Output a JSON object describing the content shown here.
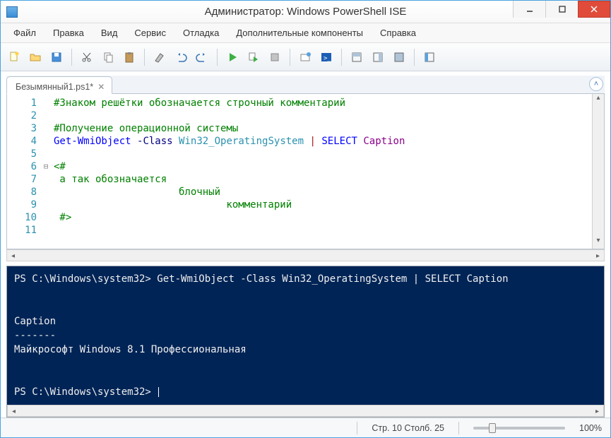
{
  "window": {
    "title": "Администратор: Windows PowerShell ISE"
  },
  "menu": {
    "file": "Файл",
    "edit": "Правка",
    "view": "Вид",
    "tools": "Сервис",
    "debug": "Отладка",
    "addons": "Дополнительные компоненты",
    "help": "Справка"
  },
  "toolbar_icons": {
    "new": "new-file",
    "open": "open-folder",
    "save": "save",
    "cut": "cut",
    "copy": "copy",
    "paste": "paste",
    "clear": "clear",
    "undo": "undo",
    "redo": "redo",
    "run": "run",
    "run_sel": "run-selection",
    "stop": "stop",
    "new_remote": "new-remote-tab",
    "ps": "start-powershell",
    "pane1": "show-script-top",
    "pane2": "show-script-right",
    "pane3": "show-script-max",
    "cmd_addon": "show-command-addon"
  },
  "tab": {
    "label": "Безымянный1.ps1*"
  },
  "editor": {
    "line_numbers": [
      "1",
      "2",
      "3",
      "4",
      "5",
      "6",
      "7",
      "8",
      "9",
      "10",
      "11"
    ],
    "fold_markers": {
      "6": "⊟"
    },
    "lines": [
      {
        "segments": [
          {
            "t": "#Знаком решётки обозначается строчный комментарий",
            "c": "c-comment"
          }
        ]
      },
      {
        "segments": []
      },
      {
        "segments": [
          {
            "t": "#Получение операционной системы",
            "c": "c-comment"
          }
        ]
      },
      {
        "segments": [
          {
            "t": "Get-WmiObject",
            "c": "c-cmd"
          },
          {
            "t": " ",
            "c": ""
          },
          {
            "t": "-Class",
            "c": "c-param"
          },
          {
            "t": " ",
            "c": ""
          },
          {
            "t": "Win32_OperatingSystem",
            "c": "c-type"
          },
          {
            "t": " ",
            "c": ""
          },
          {
            "t": "|",
            "c": "c-op"
          },
          {
            "t": " ",
            "c": ""
          },
          {
            "t": "SELECT",
            "c": "c-kw"
          },
          {
            "t": " ",
            "c": ""
          },
          {
            "t": "Caption",
            "c": "c-ident"
          }
        ]
      },
      {
        "segments": []
      },
      {
        "segments": [
          {
            "t": "<#",
            "c": "c-comment"
          }
        ]
      },
      {
        "segments": [
          {
            "t": " а так обозначается",
            "c": "c-comment"
          }
        ]
      },
      {
        "segments": [
          {
            "t": "                     блочный",
            "c": "c-comment"
          }
        ]
      },
      {
        "segments": [
          {
            "t": "                             комментарий",
            "c": "c-comment"
          }
        ]
      },
      {
        "segments": [
          {
            "t": " #>",
            "c": "c-comment"
          }
        ]
      },
      {
        "segments": []
      }
    ]
  },
  "console_output": {
    "prompt1": "PS C:\\Windows\\system32>",
    "cmd1": " Get-WmiObject -Class Win32_OperatingSystem | SELECT Caption",
    "blank": "",
    "hdr": "Caption",
    "rule": "-------",
    "val": "Майкрософт Windows 8.1 Профессиональная",
    "prompt2": "PS C:\\Windows\\system32> "
  },
  "status": {
    "pos": "Стр. 10 Столб. 25",
    "zoom": "100%"
  }
}
